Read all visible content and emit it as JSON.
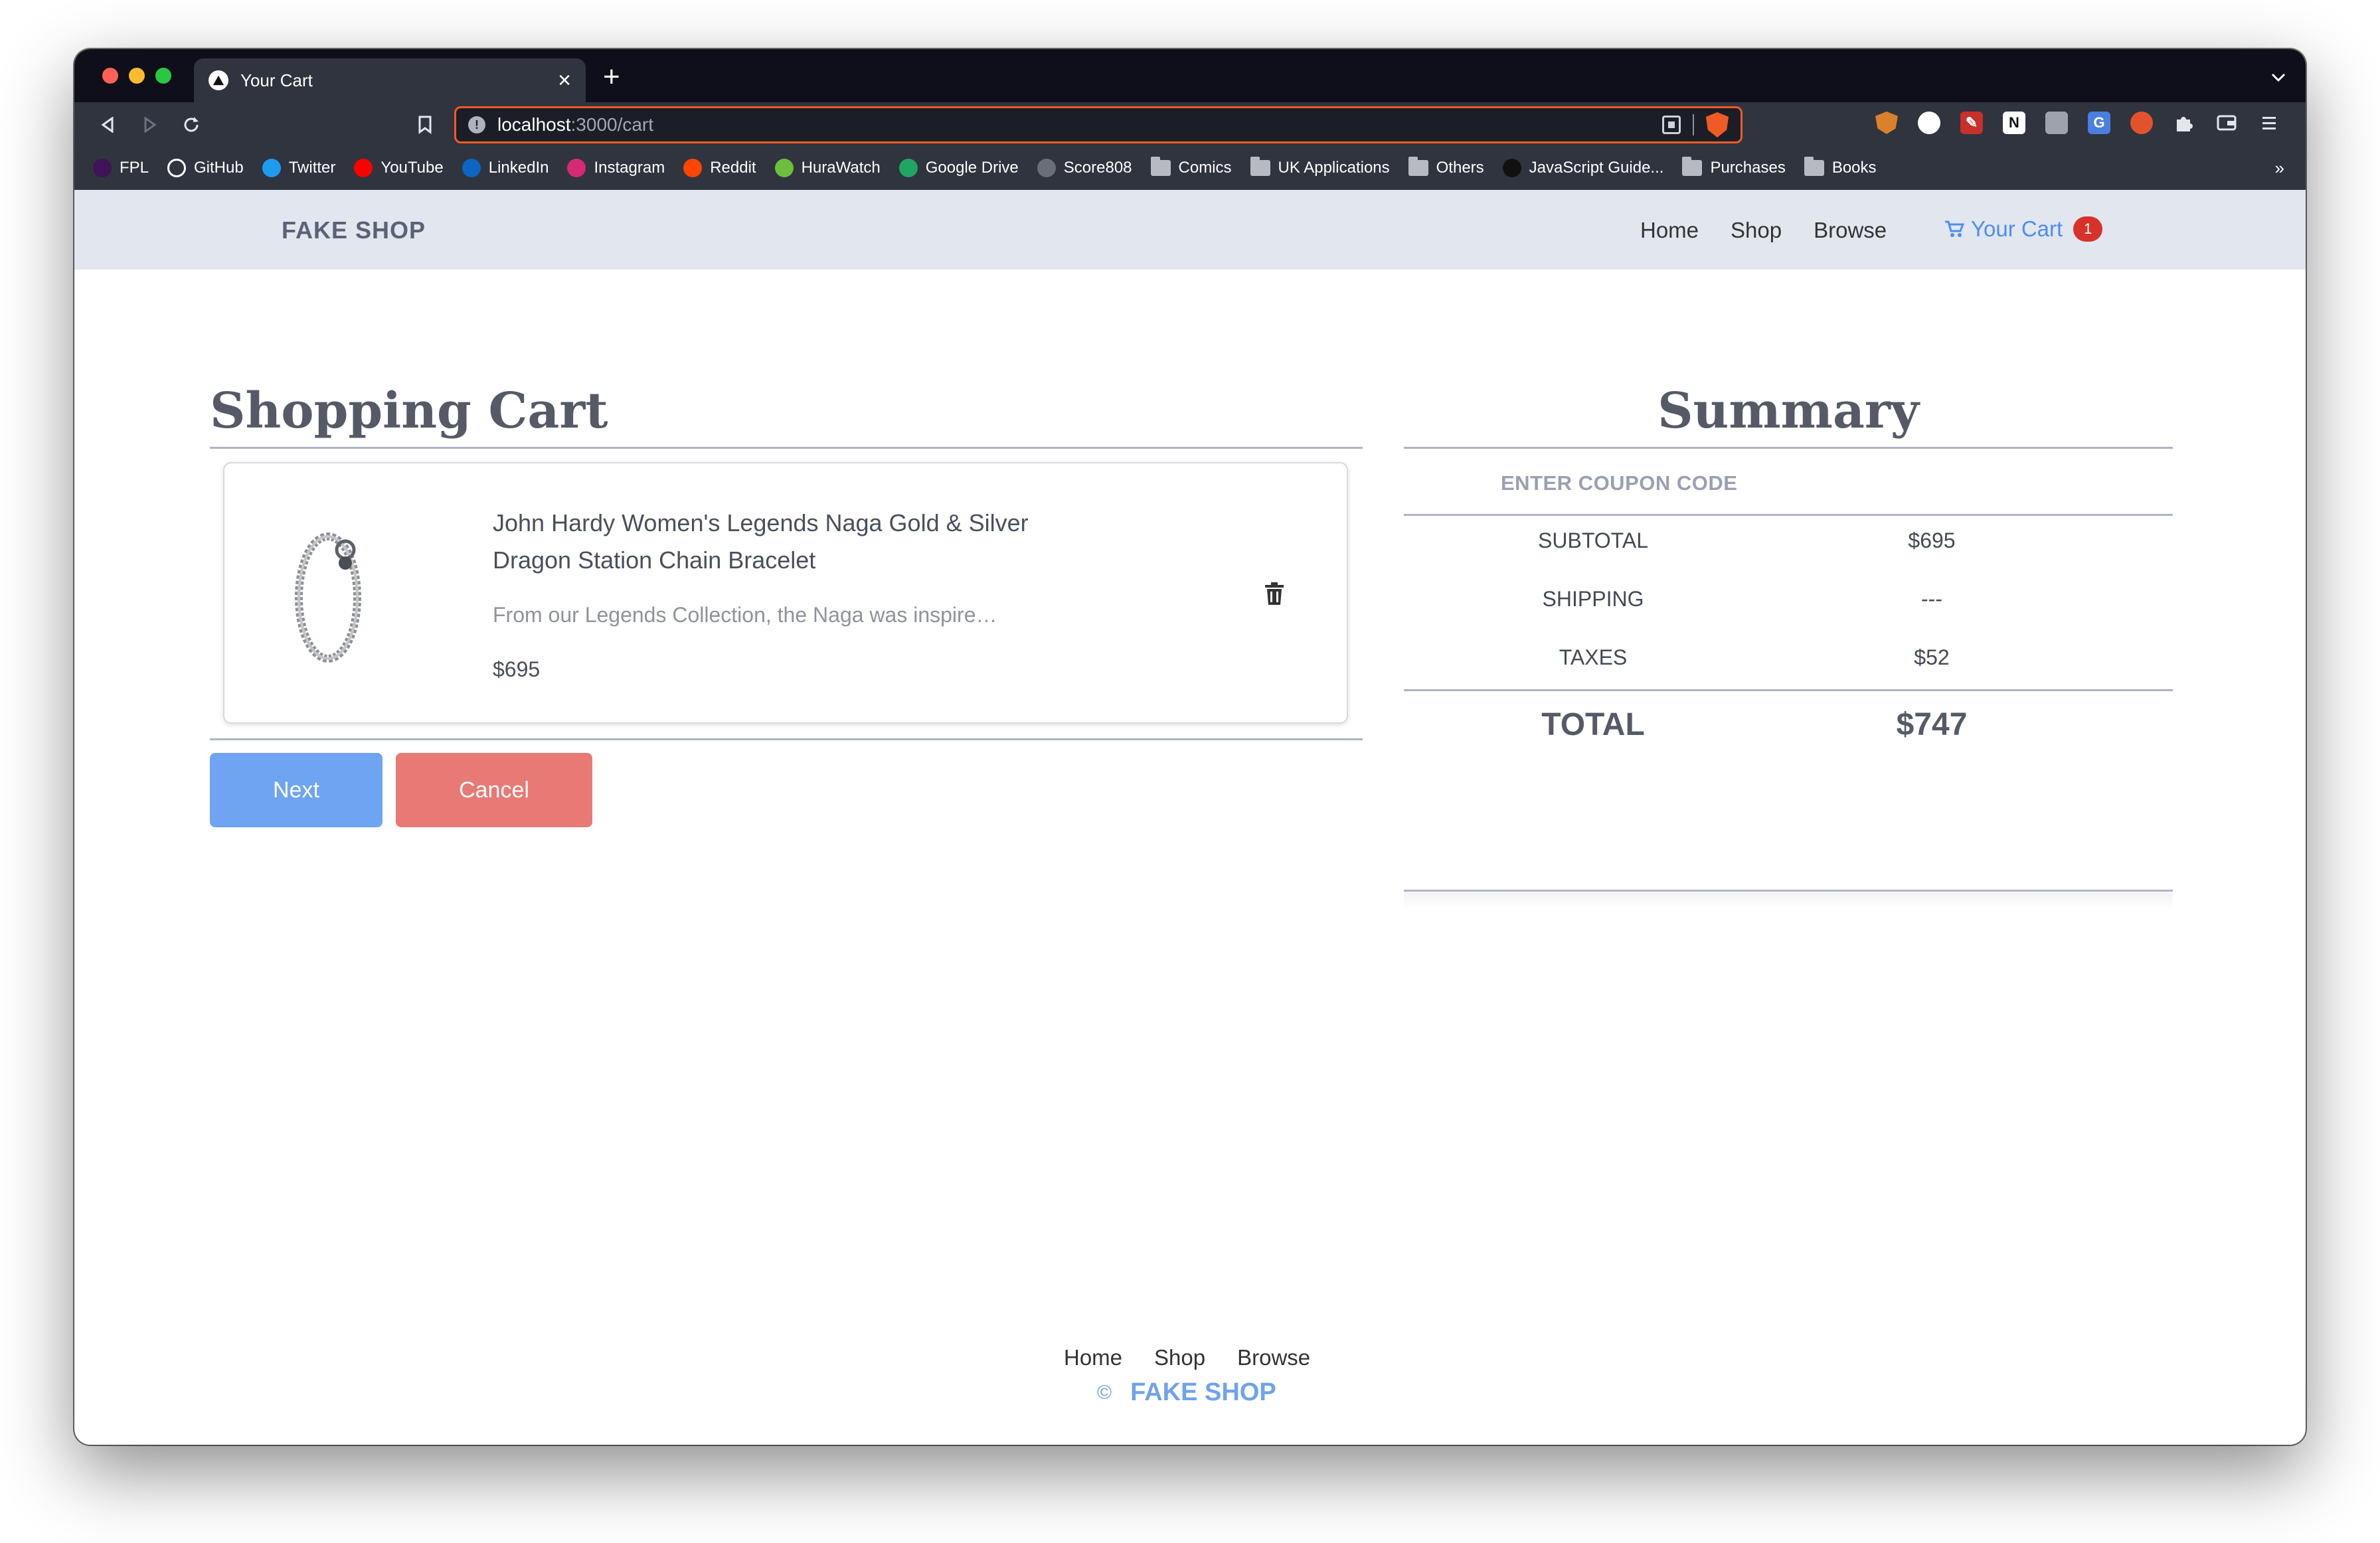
{
  "browser": {
    "tab_title": "Your Cart",
    "new_tab": "+",
    "tab_close": "×",
    "url_host": "localhost",
    "url_rest": ":3000/cart",
    "bookmarks": [
      {
        "label": "FPL",
        "icon": "fpl-icon",
        "color": "#3d1456"
      },
      {
        "label": "GitHub",
        "icon": "github-icon",
        "color": "#ffffff"
      },
      {
        "label": "Twitter",
        "icon": "twitter-icon",
        "color": "#1d9bf0"
      },
      {
        "label": "YouTube",
        "icon": "youtube-icon",
        "color": "#ff0000"
      },
      {
        "label": "LinkedIn",
        "icon": "linkedin-icon",
        "color": "#0a66c2"
      },
      {
        "label": "Instagram",
        "icon": "instagram-icon",
        "color": "#d62976"
      },
      {
        "label": "Reddit",
        "icon": "reddit-icon",
        "color": "#ff4500"
      },
      {
        "label": "HuraWatch",
        "icon": "hurawatch-icon",
        "color": "#6bbf3a"
      },
      {
        "label": "Google Drive",
        "icon": "google-drive-icon",
        "color": "#1fa463"
      },
      {
        "label": "Score808",
        "icon": "score808-icon",
        "color": "#6a6e79"
      },
      {
        "label": "Comics",
        "icon": "folder-icon"
      },
      {
        "label": "UK Applications",
        "icon": "folder-icon"
      },
      {
        "label": "Others",
        "icon": "folder-icon"
      },
      {
        "label": "JavaScript Guide...",
        "icon": "medium-icon",
        "color": "#111111"
      },
      {
        "label": "Purchases",
        "icon": "folder-icon"
      },
      {
        "label": "Books",
        "icon": "folder-icon"
      }
    ],
    "bookmarks_more": "»"
  },
  "site": {
    "brand": "FAKE SHOP",
    "nav": {
      "home": "Home",
      "shop": "Shop",
      "browse": "Browse"
    },
    "cart_label": "Your Cart",
    "cart_count": "1"
  },
  "cart": {
    "title": "Shopping Cart",
    "item": {
      "name": "John Hardy Women's Legends Naga Gold & Silver Dragon Station Chain Bracelet",
      "description": "From our Legends Collection, the Naga was inspire…",
      "price": "$695"
    },
    "next_label": "Next",
    "cancel_label": "Cancel"
  },
  "summary": {
    "title": "Summary",
    "coupon": "ENTER COUPON CODE",
    "subtotal_label": "SUBTOTAL",
    "subtotal_value": "$695",
    "shipping_label": "SHIPPING",
    "shipping_value": "---",
    "taxes_label": "TAXES",
    "taxes_value": "$52",
    "total_label": "TOTAL",
    "total_value": "$747"
  },
  "footer": {
    "nav": {
      "home": "Home",
      "shop": "Shop",
      "browse": "Browse"
    },
    "copyright": "©",
    "brand": "FAKE SHOP"
  },
  "colors": {
    "accent": "#4c8ef0",
    "next_button": "#6ea4f2",
    "cancel_button": "#e87975",
    "badge": "#d7322a",
    "header_bg": "#e2e6ef"
  }
}
